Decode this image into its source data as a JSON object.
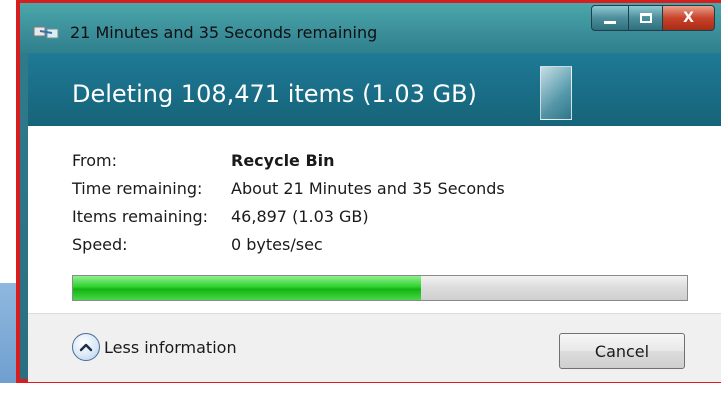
{
  "window": {
    "title": "21 Minutes and 35 Seconds remaining",
    "minimize_icon": "minimize-icon",
    "maximize_icon": "maximize-icon",
    "close_icon": "close-icon",
    "close_glyph": "X"
  },
  "header": {
    "text": "Deleting 108,471 items (1.03 GB)"
  },
  "details": [
    {
      "label": "From:",
      "value": "Recycle Bin",
      "bold": true
    },
    {
      "label": "Time remaining:",
      "value": "About 21 Minutes and 35 Seconds",
      "bold": false
    },
    {
      "label": "Items remaining:",
      "value": "46,897 (1.03 GB)",
      "bold": false
    },
    {
      "label": "Speed:",
      "value": "0 bytes/sec",
      "bold": false
    }
  ],
  "progress": {
    "fraction": 0.567,
    "fill_color": "#22c622"
  },
  "footer": {
    "less_info_label": "Less information",
    "less_info_icon": "chevron-up-icon",
    "cancel_label": "Cancel"
  },
  "colors": {
    "frame_accent": "#d61e1e",
    "header_band": "#1a6e88",
    "close_button": "#c8432a"
  }
}
